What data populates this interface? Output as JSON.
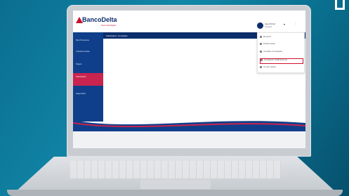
{
  "brand": {
    "name": "BancoDelta",
    "tagline": "Sucursal Digital"
  },
  "user": {
    "name": "Juan Pérez",
    "role": "Usuario"
  },
  "topbar": {
    "title": "Solicitudes / Consultas"
  },
  "sidebar": {
    "items": [
      {
        "label": "Mis Productos"
      },
      {
        "label": "Transferencias"
      },
      {
        "label": "Pagos"
      },
      {
        "label": "Solicitudes"
      },
      {
        "label": "Seguridad"
      }
    ]
  },
  "dropdown": {
    "items": [
      {
        "label": "Mi perfil"
      },
      {
        "label": "Preferencias"
      },
      {
        "label": "Cambiar contraseña"
      },
      {
        "label": "Configurar notificaciones"
      },
      {
        "label": "Cerrar sesión"
      }
    ]
  },
  "colors": {
    "primary": "#0f3f8a",
    "accent": "#c8244f",
    "highlight": "#d0102e",
    "background": "#0b6e90"
  },
  "icons": {
    "corner": "frame-corner-icon",
    "menu": "menu-dots-icon",
    "caret": "chevron-down-icon"
  }
}
